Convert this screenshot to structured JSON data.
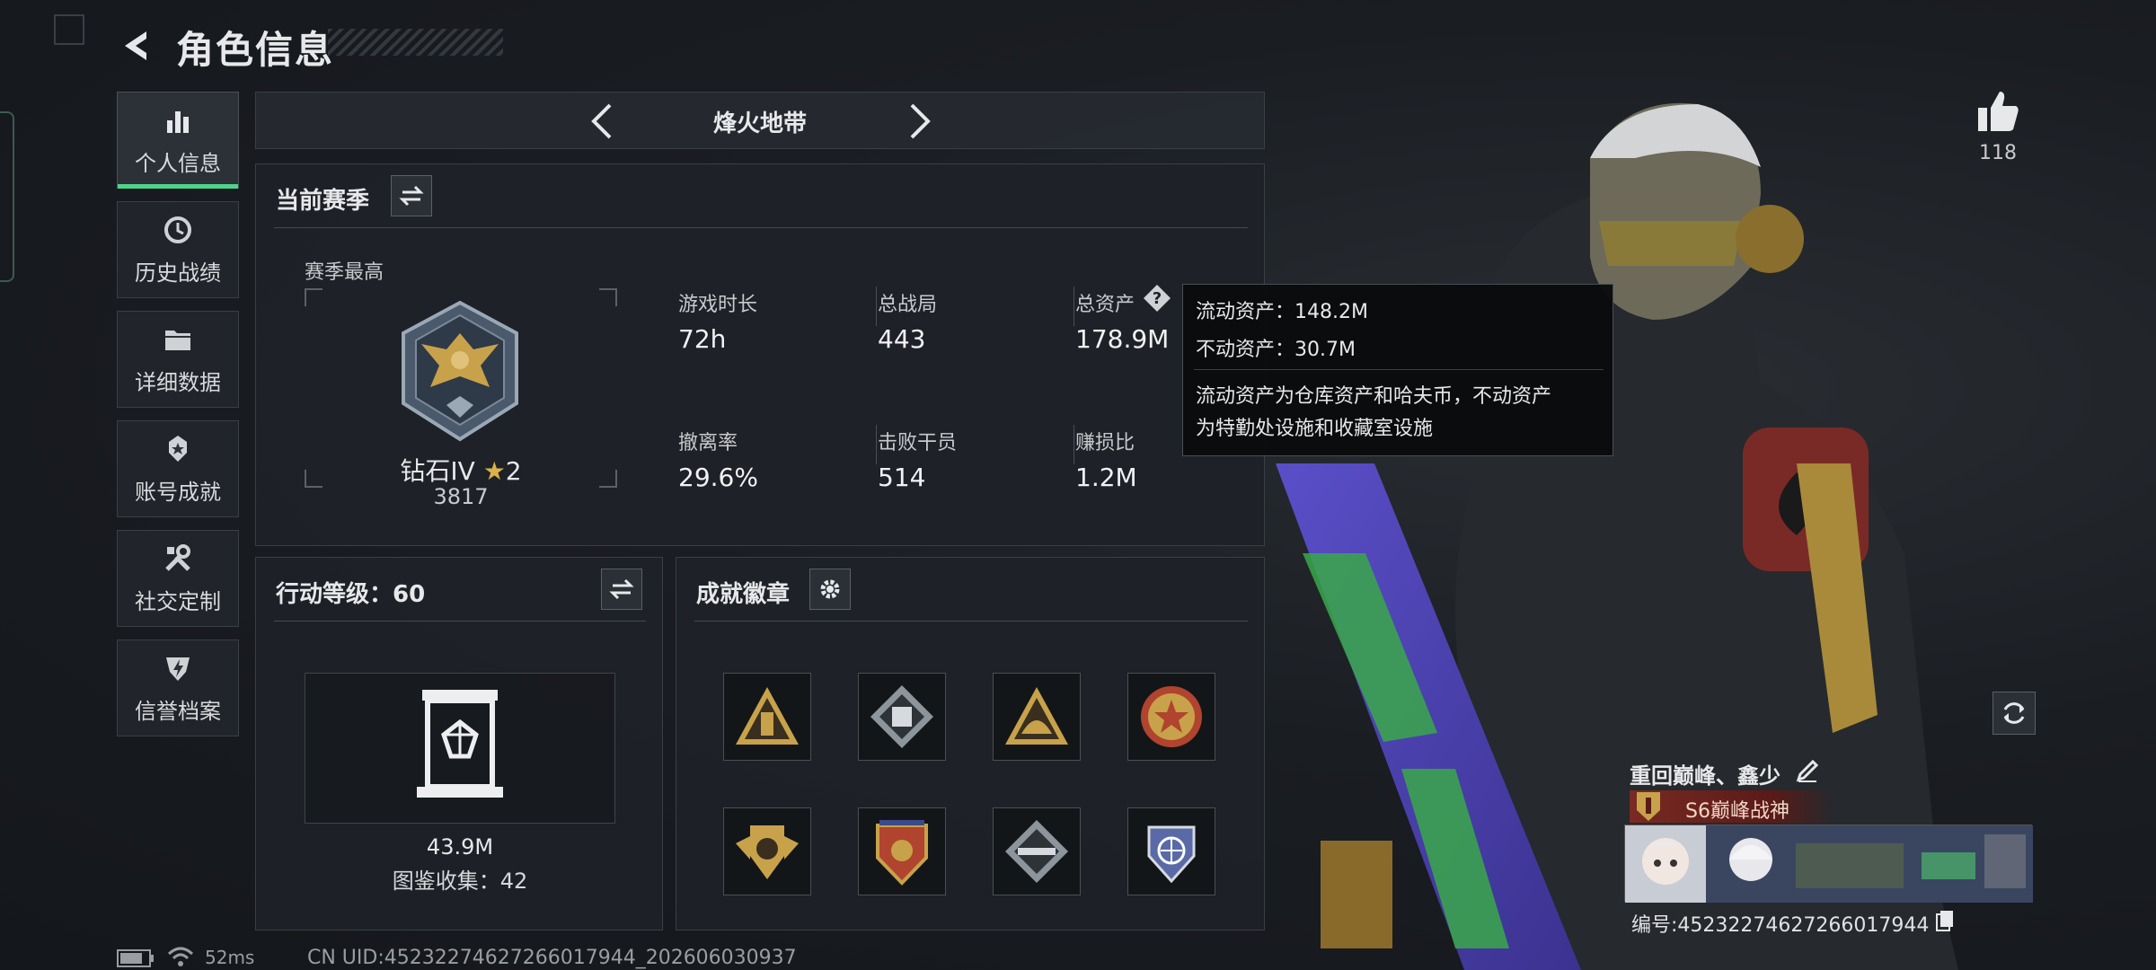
{
  "header": {
    "title": "角色信息"
  },
  "nav": [
    {
      "label": "个人信息",
      "icon": "bar-chart-icon",
      "active": true
    },
    {
      "label": "历史战绩",
      "icon": "history-icon",
      "active": false
    },
    {
      "label": "详细数据",
      "icon": "folder-icon",
      "active": false
    },
    {
      "label": "账号成就",
      "icon": "medal-icon",
      "active": false
    },
    {
      "label": "社交定制",
      "icon": "wrench-icon",
      "active": false
    },
    {
      "label": "信誉档案",
      "icon": "shield-icon",
      "active": false
    }
  ],
  "mode": {
    "title": "烽火地带"
  },
  "season": {
    "title": "当前赛季",
    "best_label": "赛季最高",
    "rank_name": "钻石IV",
    "rank_stars": "2",
    "rank_score": "3817",
    "stats": [
      {
        "label": "游戏时长",
        "value": "72h"
      },
      {
        "label": "总战局",
        "value": "443"
      },
      {
        "label": "总资产",
        "value": "178.9M"
      },
      {
        "label": "撤离率",
        "value": "29.6%"
      },
      {
        "label": "击败干员",
        "value": "514"
      },
      {
        "label": "赚损比",
        "value": "1.2M"
      }
    ]
  },
  "tooltip": {
    "liquid": "流动资产：148.2M",
    "fixed": "不动资产：30.7M",
    "desc_line1": "流动资产为仓库资产和哈夫币，不动资产",
    "desc_line2": "为特勤处设施和收藏室设施"
  },
  "level": {
    "title": "行动等级：60",
    "collection_value": "43.9M",
    "collection_count": "图鉴收集：42"
  },
  "badges": {
    "title": "成就徽章",
    "items": [
      "triangle-tower-badge",
      "diamond-crate-badge",
      "triangle-dome-badge",
      "star-medal-badge",
      "shield-wings-badge",
      "crest-shield-badge",
      "diamond-rifle-badge",
      "sphere-shield-badge"
    ]
  },
  "social": {
    "like_count": "118"
  },
  "player": {
    "name": "重回巅峰、鑫少",
    "title": "S6巅峰战神",
    "id_text": "编号:4523227462726601​7944"
  },
  "footer": {
    "latency": "52ms",
    "uid": "CN UID:4523227462726601​7944_202606030937"
  },
  "colors": {
    "accent": "#4cd48a",
    "gold": "#c8a24a",
    "title_red": "#7a2a22"
  }
}
